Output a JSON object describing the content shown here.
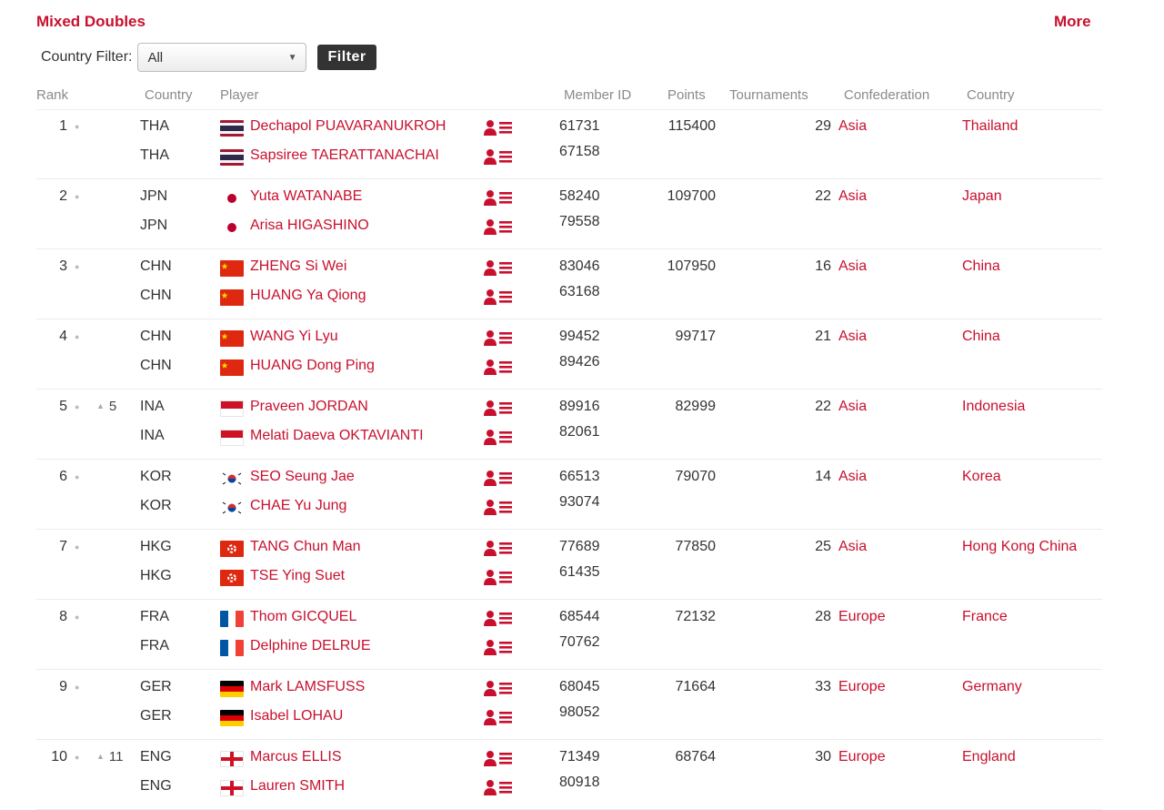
{
  "header": {
    "title": "Mixed Doubles",
    "more_label": "More"
  },
  "filter": {
    "label": "Country Filter:",
    "selected": "All",
    "button_label": "Filter"
  },
  "columns": {
    "rank": "Rank",
    "country_code": "Country",
    "player": "Player",
    "member_id": "Member ID",
    "points": "Points",
    "tournaments": "Tournaments",
    "confederation": "Confederation",
    "country": "Country"
  },
  "colors": {
    "accent": "#c8102e",
    "button_bg": "#333333"
  },
  "teams": [
    {
      "rank": "1",
      "prev_rank": "",
      "points": "115400",
      "tournaments": "29",
      "confederation": "Asia",
      "country": "Thailand",
      "players": [
        {
          "code": "THA",
          "flag": "thailand-flag",
          "name": "Dechapol PUAVARANUKROH",
          "member_id": "61731"
        },
        {
          "code": "THA",
          "flag": "thailand-flag",
          "name": "Sapsiree TAERATTANACHAI",
          "member_id": "67158"
        }
      ]
    },
    {
      "rank": "2",
      "prev_rank": "",
      "points": "109700",
      "tournaments": "22",
      "confederation": "Asia",
      "country": "Japan",
      "players": [
        {
          "code": "JPN",
          "flag": "japan-flag",
          "name": "Yuta WATANABE",
          "member_id": "58240"
        },
        {
          "code": "JPN",
          "flag": "japan-flag",
          "name": "Arisa HIGASHINO",
          "member_id": "79558"
        }
      ]
    },
    {
      "rank": "3",
      "prev_rank": "",
      "points": "107950",
      "tournaments": "16",
      "confederation": "Asia",
      "country": "China",
      "players": [
        {
          "code": "CHN",
          "flag": "china-flag",
          "name": "ZHENG Si Wei",
          "member_id": "83046"
        },
        {
          "code": "CHN",
          "flag": "china-flag",
          "name": "HUANG Ya Qiong",
          "member_id": "63168"
        }
      ]
    },
    {
      "rank": "4",
      "prev_rank": "",
      "points": "99717",
      "tournaments": "21",
      "confederation": "Asia",
      "country": "China",
      "players": [
        {
          "code": "CHN",
          "flag": "china-flag",
          "name": "WANG Yi Lyu",
          "member_id": "99452"
        },
        {
          "code": "CHN",
          "flag": "china-flag",
          "name": "HUANG Dong Ping",
          "member_id": "89426"
        }
      ]
    },
    {
      "rank": "5",
      "prev_rank": "5",
      "points": "82999",
      "tournaments": "22",
      "confederation": "Asia",
      "country": "Indonesia",
      "players": [
        {
          "code": "INA",
          "flag": "indonesia-flag",
          "name": "Praveen JORDAN",
          "member_id": "89916"
        },
        {
          "code": "INA",
          "flag": "indonesia-flag",
          "name": "Melati Daeva OKTAVIANTI",
          "member_id": "82061"
        }
      ]
    },
    {
      "rank": "6",
      "prev_rank": "",
      "points": "79070",
      "tournaments": "14",
      "confederation": "Asia",
      "country": "Korea",
      "players": [
        {
          "code": "KOR",
          "flag": "korea-flag",
          "name": "SEO Seung Jae",
          "member_id": "66513"
        },
        {
          "code": "KOR",
          "flag": "korea-flag",
          "name": "CHAE Yu Jung",
          "member_id": "93074"
        }
      ]
    },
    {
      "rank": "7",
      "prev_rank": "",
      "points": "77850",
      "tournaments": "25",
      "confederation": "Asia",
      "country": "Hong Kong China",
      "players": [
        {
          "code": "HKG",
          "flag": "hong-kong-flag",
          "name": "TANG Chun Man",
          "member_id": "77689"
        },
        {
          "code": "HKG",
          "flag": "hong-kong-flag",
          "name": "TSE Ying Suet",
          "member_id": "61435"
        }
      ]
    },
    {
      "rank": "8",
      "prev_rank": "",
      "points": "72132",
      "tournaments": "28",
      "confederation": "Europe",
      "country": "France",
      "players": [
        {
          "code": "FRA",
          "flag": "france-flag",
          "name": "Thom GICQUEL",
          "member_id": "68544"
        },
        {
          "code": "FRA",
          "flag": "france-flag",
          "name": "Delphine DELRUE",
          "member_id": "70762"
        }
      ]
    },
    {
      "rank": "9",
      "prev_rank": "",
      "points": "71664",
      "tournaments": "33",
      "confederation": "Europe",
      "country": "Germany",
      "players": [
        {
          "code": "GER",
          "flag": "germany-flag",
          "name": "Mark LAMSFUSS",
          "member_id": "68045"
        },
        {
          "code": "GER",
          "flag": "germany-flag",
          "name": "Isabel LOHAU",
          "member_id": "98052"
        }
      ]
    },
    {
      "rank": "10",
      "prev_rank": "11",
      "points": "68764",
      "tournaments": "30",
      "confederation": "Europe",
      "country": "England",
      "players": [
        {
          "code": "ENG",
          "flag": "england-flag",
          "name": "Marcus ELLIS",
          "member_id": "71349"
        },
        {
          "code": "ENG",
          "flag": "england-flag",
          "name": "Lauren SMITH",
          "member_id": "80918"
        }
      ]
    }
  ]
}
